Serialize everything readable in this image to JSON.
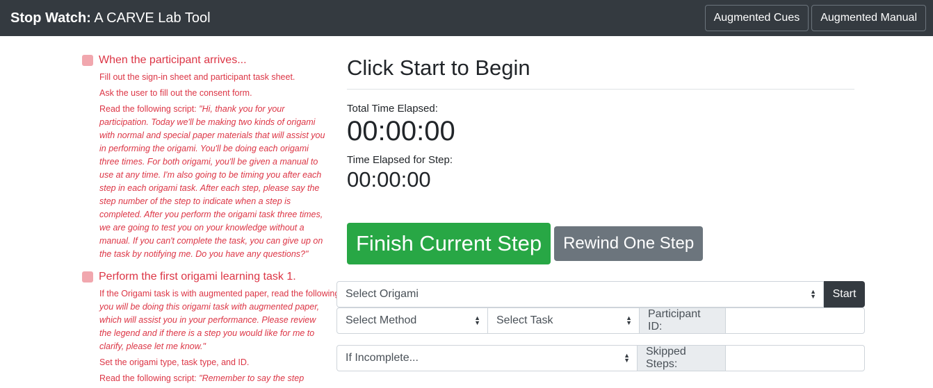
{
  "navbar": {
    "brand_bold": "Stop Watch:",
    "brand_rest": " A CARVE Lab Tool",
    "buttons": [
      "Augmented Cues",
      "Augmented Manual"
    ]
  },
  "checklist": {
    "step1": {
      "title": "When the participant arrives...",
      "items": [
        "Fill out the sign-in sheet and participant task sheet.",
        "Ask the user to fill out the consent form."
      ],
      "script_prefix": "Read the following script: ",
      "script": "\"Hi, thank you for your participation. Today we'll be making two kinds of origami with normal and special paper materials that will assist you in performing the origami. You'll be doing each origami three times. For both origami, you'll be given a manual to use at any time. I'm also going to be timing you after each step in each origami task. After each step, please say the step number of the step to indicate when a step is completed. After you perform the origami task three times, we are going to test you on your knowledge without a manual. If you can't complete the task, you can give up on the task by notifying me. Do you have any questions?\""
    },
    "step2": {
      "title": "Perform the first origami learning task 1.",
      "item1_prefix": "If the Origami task is with augmented paper, read the following script: ",
      "item1_script": "\"Now you will be doing this origami task with augmented paper, which will assist you in your performance. Please review the legend and if there is a step you would like for me to clarify, please let me know.\"",
      "item2": "Set the origami type, task type, and ID.",
      "item3_prefix": "Read the following script: ",
      "item3_script": "\"Remember to say the step"
    }
  },
  "main": {
    "heading": "Click Start to Begin",
    "total_label": "Total Time Elapsed:",
    "total_time": "00:00:00",
    "step_label": "Time Elapsed for Step:",
    "step_time": "00:00:00",
    "finish_button": "Finish Current Step",
    "rewind_button": "Rewind One Step"
  },
  "form": {
    "origami_select": "Select Origami",
    "start_button": "Start",
    "method_select": "Select Method",
    "task_select": "Select Task",
    "participant_label": "Participant ID:",
    "participant_value": "",
    "incomplete_select": "If Incomplete...",
    "skipped_label": "Skipped Steps:",
    "skipped_value": ""
  }
}
